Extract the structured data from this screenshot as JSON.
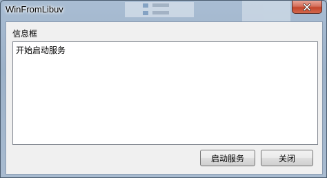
{
  "window": {
    "title": "WinFromLibuv"
  },
  "group": {
    "label": "信息框"
  },
  "log": {
    "text": "开始启动服务"
  },
  "buttons": {
    "start_label": "启动服务",
    "close_label": "关闭"
  },
  "colors": {
    "close_button": "#c94f38",
    "client_bg": "#f0f0f0"
  }
}
